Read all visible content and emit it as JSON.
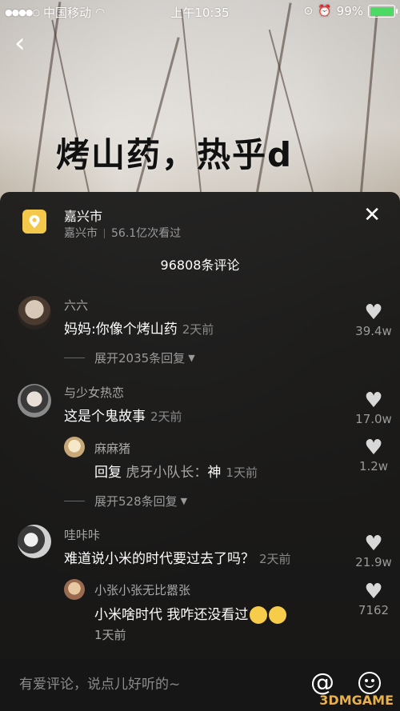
{
  "status_bar": {
    "carrier": "中国移动",
    "time": "上午10:35",
    "battery": "99%"
  },
  "video": {
    "title": "烤山药，热乎d"
  },
  "location": {
    "name": "嘉兴市",
    "sub_city": "嘉兴市",
    "views": "56.1亿次看过"
  },
  "comments_header": "96808条评论",
  "comments": [
    {
      "user": "六六",
      "text": "妈妈:你像个烤山药",
      "time": "2天前",
      "likes": "39.4w",
      "expand": "展开2035条回复"
    },
    {
      "user": "与少女热恋",
      "text": "这是个鬼故事",
      "time": "2天前",
      "likes": "17.0w",
      "reply": {
        "user": "麻麻猪",
        "prefix": "回复",
        "to": "虎牙小队长：",
        "text": "神",
        "time": "1天前",
        "likes": "1.2w"
      },
      "expand": "展开528条回复"
    },
    {
      "user": "哇咔咔",
      "text": "难道说小米的时代要过去了吗？",
      "time": "2天前",
      "likes": "21.9w",
      "reply": {
        "user": "小张小张无比嚣张",
        "text": "小米啥时代 我咋还没看过",
        "time": "1天前",
        "likes": "7162"
      }
    }
  ],
  "input": {
    "placeholder": "有爱评论，说点儿好听的~"
  },
  "watermark": "3DMGAME",
  "colors": {
    "location_icon": "#f4c94b",
    "battery_fill": "#4cd964",
    "panel_bg": "#161616"
  }
}
